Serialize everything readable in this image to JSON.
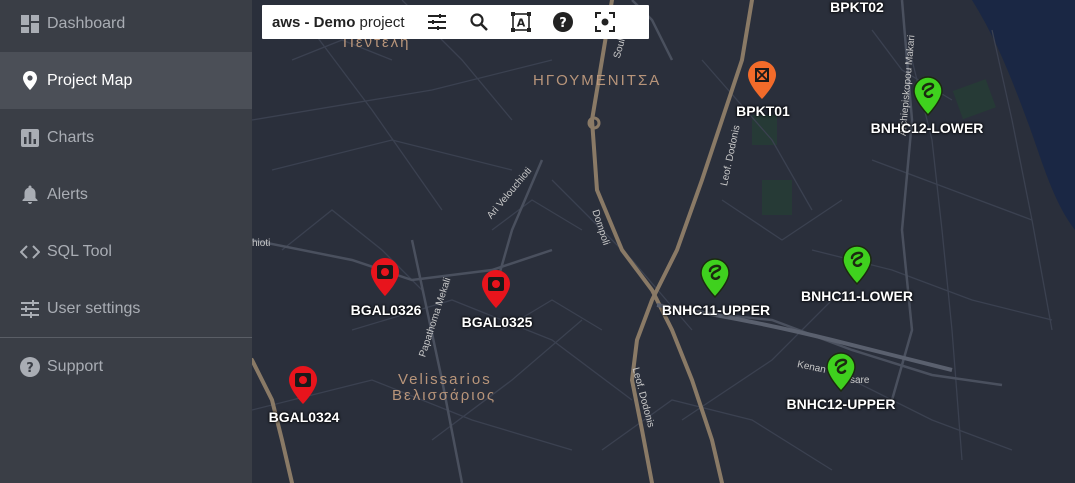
{
  "sidebar": {
    "items": [
      {
        "label": "Dashboard",
        "icon": "dashboard-icon",
        "active": false
      },
      {
        "label": "Project Map",
        "icon": "map-pin-icon",
        "active": true
      },
      {
        "label": "Charts",
        "icon": "bar-chart-icon",
        "active": false
      },
      {
        "label": "Alerts",
        "icon": "bell-icon",
        "active": false
      },
      {
        "label": "SQL Tool",
        "icon": "code-icon",
        "active": false
      },
      {
        "label": "User settings",
        "icon": "sliders-icon",
        "active": false
      },
      {
        "label": "Support",
        "icon": "help-circle-icon",
        "active": false
      }
    ]
  },
  "toolbar": {
    "title_bold": "aws - Demo",
    "title_rest": " project",
    "buttons": [
      "filter-icon",
      "search-icon",
      "text-select-icon",
      "help-icon",
      "focus-icon"
    ]
  },
  "map": {
    "area_labels": [
      "Πεντελη",
      "ΗΓΟΥΜΕΝΙΤΣΑ",
      "Velissarios",
      "Βελισσάριος"
    ],
    "road_labels": [
      "Souli",
      "Leof. Dodonis",
      "Ari Velouchioti",
      "Dompoli",
      "hioti",
      "Papathoma Mekali",
      "Leof. Dodonis",
      "Kenan",
      "sare",
      "Archiepiskopou Makari"
    ],
    "markers": [
      {
        "label": "BPKT02",
        "kind": "none"
      },
      {
        "label": "BPKT01",
        "kind": "orange"
      },
      {
        "label": "BNHC12-LOWER",
        "kind": "green"
      },
      {
        "label": "BGAL0326",
        "kind": "red"
      },
      {
        "label": "BGAL0325",
        "kind": "red"
      },
      {
        "label": "BNHC11-UPPER",
        "kind": "green"
      },
      {
        "label": "BNHC11-LOWER",
        "kind": "green"
      },
      {
        "label": "BGAL0324",
        "kind": "red"
      },
      {
        "label": "BNHC12-UPPER",
        "kind": "green"
      }
    ]
  },
  "colors": {
    "sidebar_bg": "#3a3e46",
    "sidebar_active": "#4b4f57",
    "map_bg": "#2a2f3b",
    "marker_red": "#e8141c",
    "marker_green": "#3fd11e",
    "marker_orange": "#f26b2a"
  }
}
